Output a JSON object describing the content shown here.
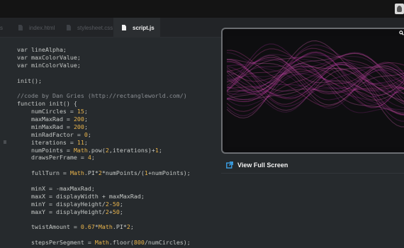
{
  "header": {
    "avatar": "user-avatar"
  },
  "tabs": [
    {
      "label": "s",
      "active": false
    },
    {
      "label": "index.html",
      "active": false
    },
    {
      "label": "stylesheet.css",
      "active": false
    },
    {
      "label": "script.js",
      "active": true
    }
  ],
  "code_lines": [
    "var lineAlpha;",
    "var maxColorValue;",
    "var minColorValue;",
    "",
    "init();",
    "",
    "//code by Dan Gries (http://rectangleworld.com/)",
    "function init() {",
    "    numCircles = 15;",
    "    maxMaxRad = 200;",
    "    minMaxRad = 200;",
    "    minRadFactor = 0;",
    "    iterations = 11;",
    "    numPoints = Math.pow(2,iterations)+1;",
    "    drawsPerFrame = 4;",
    "",
    "    fullTurn = Math.PI*2*numPoints/(1+numPoints);",
    "",
    "    minX = -maxMaxRad;",
    "    maxX = displayWidth + maxMaxRad;",
    "    minY = displayHeight/2-50;",
    "    maxY = displayHeight/2+50;",
    "",
    "    twistAmount = 0.67*Math.PI*2;",
    "",
    "    stepsPerSegment = Math.floor(800/numCircles);"
  ],
  "preview": {
    "fullscreen_label": "View Full Screen",
    "colors": {
      "accent": "#3aa0e6",
      "ribbon_pink": "#e14bb0",
      "ribbon_magenta": "#b02fa0"
    }
  }
}
